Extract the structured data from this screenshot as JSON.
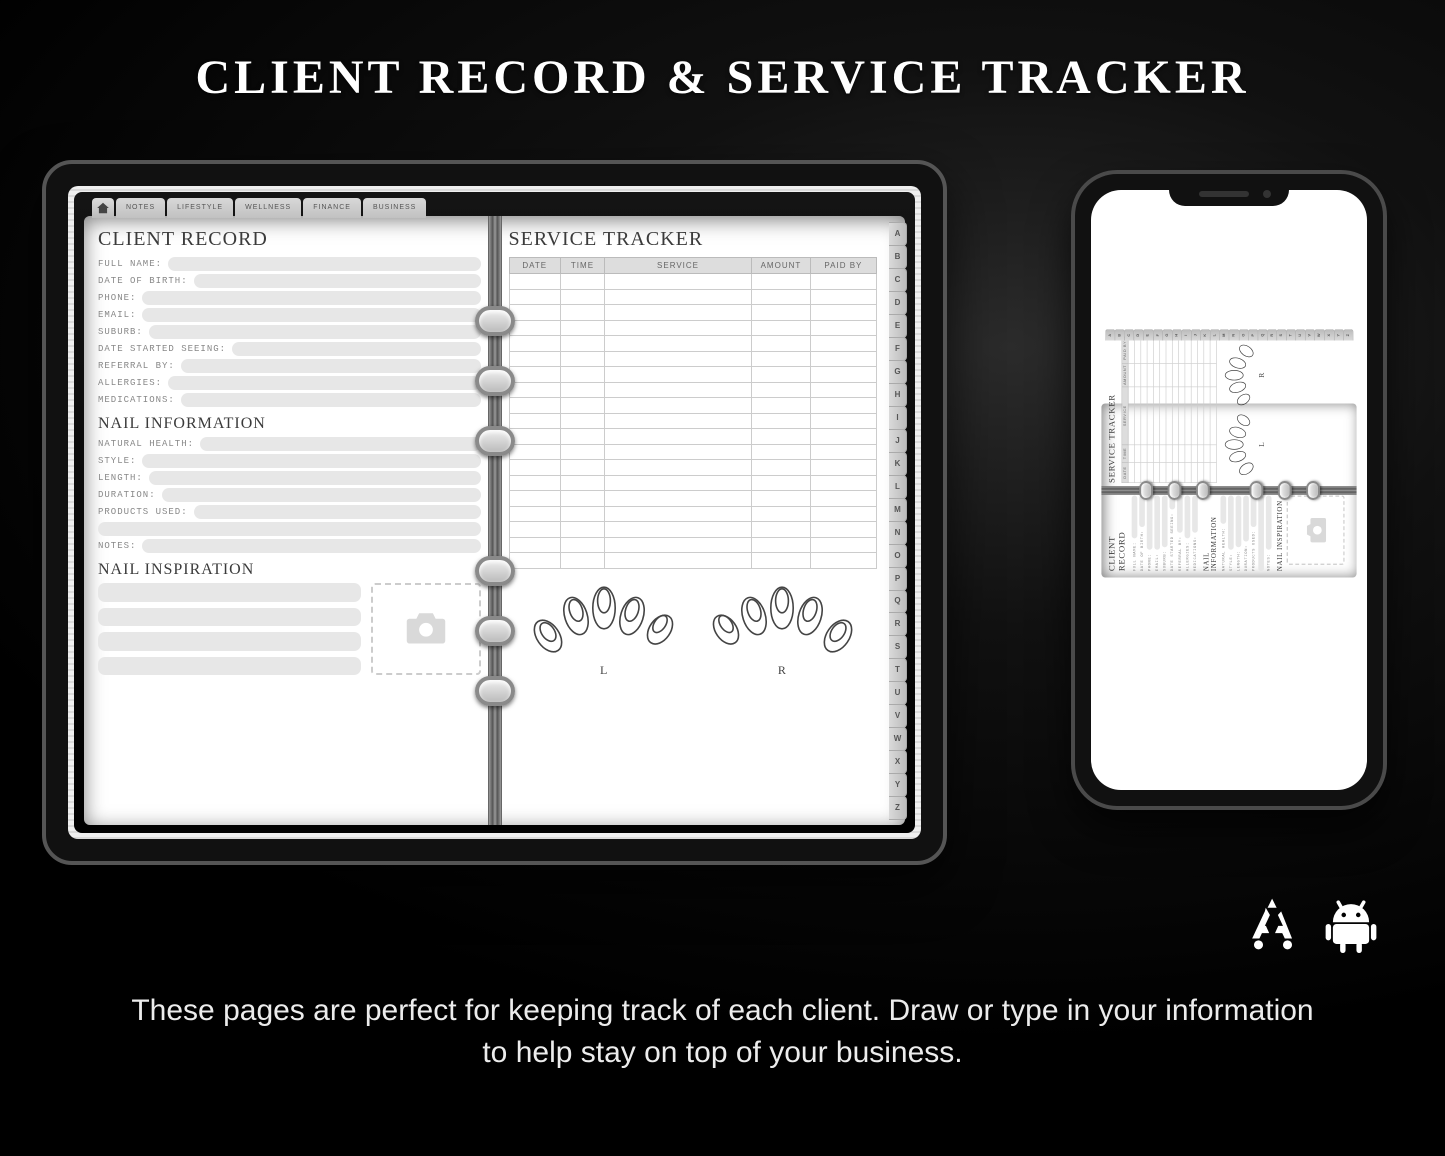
{
  "title": "CLIENT RECORD & SERVICE TRACKER",
  "caption": "These pages are perfect for keeping track of each client. Draw or type in your information to help stay on top of your business.",
  "topTabs": [
    "NOTES",
    "LIFESTYLE",
    "WELLNESS",
    "FINANCE",
    "BUSINESS"
  ],
  "alphaTabs": [
    "A",
    "B",
    "C",
    "D",
    "E",
    "F",
    "G",
    "H",
    "I",
    "J",
    "K",
    "L",
    "M",
    "N",
    "O",
    "P",
    "Q",
    "R",
    "S",
    "T",
    "U",
    "V",
    "W",
    "X",
    "Y",
    "Z"
  ],
  "leftPage": {
    "heading": "CLIENT RECORD",
    "fields1": [
      "FULL NAME:",
      "DATE OF BIRTH:",
      "PHONE:",
      "EMAIL:",
      "SUBURB:",
      "DATE STARTED SEEING:",
      "REFERRAL BY:",
      "ALLERGIES:",
      "MEDICATIONS:"
    ],
    "heading2": "NAIL INFORMATION",
    "fields2": [
      "NATURAL HEALTH:",
      "STYLE:",
      "LENGTH:",
      "DURATION:",
      "PRODUCTS USED:",
      "",
      "NOTES:"
    ],
    "heading3": "NAIL INSPIRATION"
  },
  "rightPage": {
    "heading": "SERVICE TRACKER",
    "columns": [
      "DATE",
      "TIME",
      "SERVICE",
      "AMOUNT",
      "PAID BY"
    ],
    "rowCount": 19,
    "leftHandLabel": "L",
    "rightHandLabel": "R"
  }
}
